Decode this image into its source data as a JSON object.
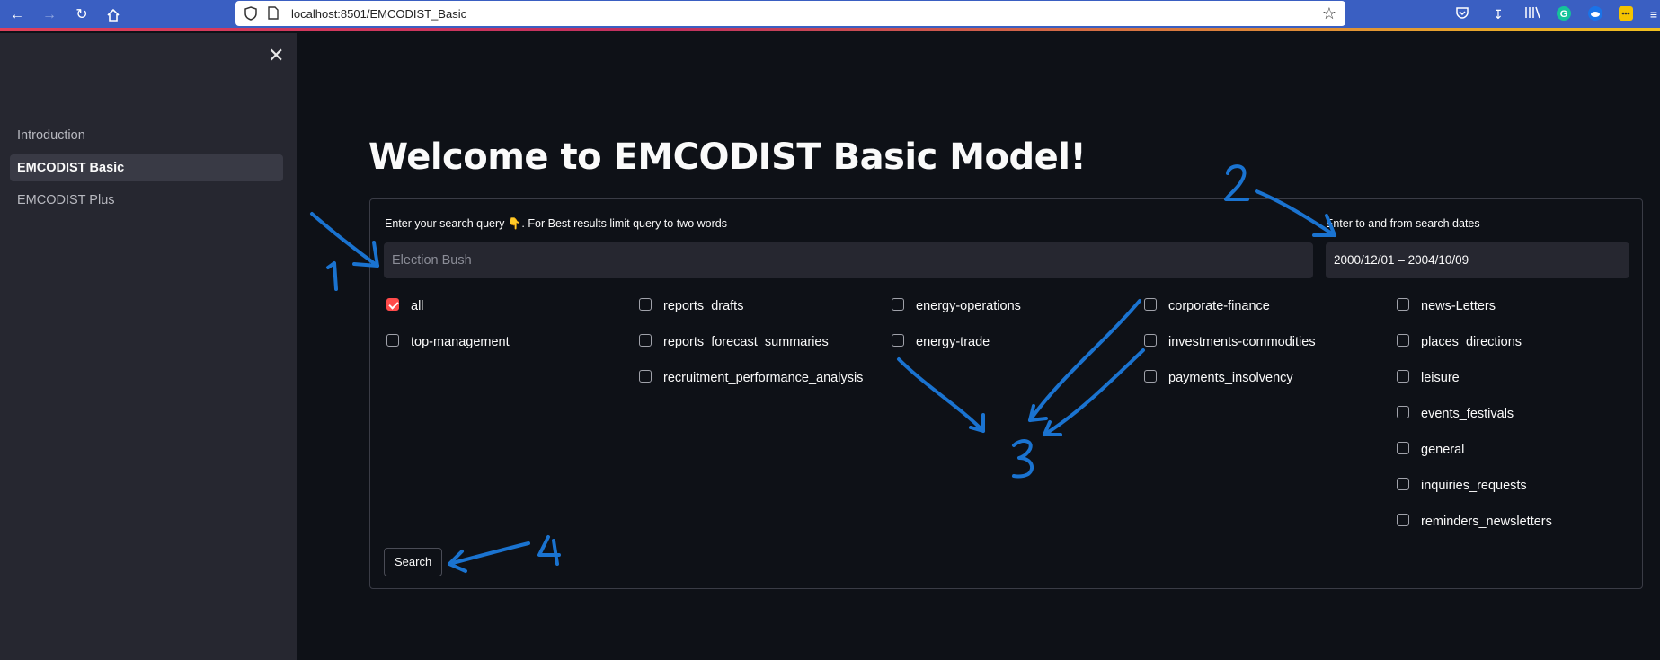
{
  "browser": {
    "url": "localhost:8501/EMCODIST_Basic",
    "icons": [
      "back-arrow-icon",
      "forward-arrow-icon",
      "reload-icon",
      "home-icon",
      "shield-icon",
      "page-icon",
      "bookmark-star-icon",
      "pocket-icon",
      "download-icon",
      "library-icon",
      "grammarly-icon",
      "cloud-extension-icon",
      "extension-icon",
      "menu-icon"
    ],
    "accent": "#3a5fc2"
  },
  "sidebar": {
    "items": [
      {
        "label": "Introduction",
        "active": false
      },
      {
        "label": "EMCODIST Basic",
        "active": true
      },
      {
        "label": "EMCODIST Plus",
        "active": false
      }
    ]
  },
  "main": {
    "title": "Welcome to EMCODIST Basic Model!",
    "query_label": "Enter your search query 👇. For Best results limit query to two words",
    "query_placeholder": "Election Bush",
    "dates_label": "Enter to and from search dates",
    "dates_value": "2000/12/01 – 2004/10/09",
    "categories": [
      [
        "all",
        "top-management"
      ],
      [
        "reports_drafts",
        "reports_forecast_summaries",
        "recruitment_performance_analysis"
      ],
      [
        "energy-operations",
        "energy-trade"
      ],
      [
        "corporate-finance",
        "investments-commodities",
        "payments_insolvency"
      ],
      [
        "news-Letters",
        "places_directions",
        "leisure",
        "events_festivals",
        "general",
        "inquiries_requests",
        "reminders_newsletters"
      ]
    ],
    "checked": [
      "all"
    ],
    "search_label": "Search"
  },
  "annotations": {
    "labels": [
      "1",
      "2",
      "3",
      "4"
    ],
    "color": "#1a73d0"
  },
  "colors": {
    "background": "#0e1117",
    "sidebar": "#262730",
    "checkbox_checked": "#ff4b4b"
  }
}
